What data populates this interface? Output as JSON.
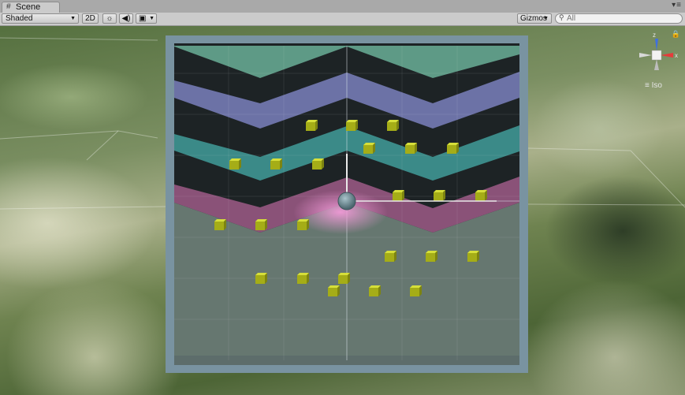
{
  "window": {
    "tab_icon": "#",
    "tab_label": "Scene",
    "tab_menu": "▾≡"
  },
  "toolbar": {
    "shading_mode": "Shaded",
    "btn_2d": "2D",
    "lighting_icon": "☼",
    "audio_icon": "◀)",
    "effects_icon": "▣",
    "gizmos_label": "Gizmos",
    "search_placeholder": "All"
  },
  "gizmo": {
    "x_label": "x",
    "y_label": "y",
    "z_label": "z",
    "projection": "≡ Iso"
  },
  "icons": [
    "scene-tab-icon",
    "dropdown-arrow-icon",
    "lighting-icon",
    "audio-icon",
    "effects-icon",
    "search-icon",
    "lock-icon",
    "orientation-gizmo-icon"
  ],
  "colors": {
    "band_top": "#5e9a86",
    "band_blue": "#6c72a6",
    "band_teal": "#3b8a88",
    "band_pink": "#8a5278",
    "band_dark": "#1d2325",
    "board_frame": "#7993a1",
    "lower_field": "#667770",
    "cube": "#b8c21b",
    "ball": "#6b8a93",
    "axis_x": "#e53b3b",
    "axis_y": "#7bd04a",
    "axis_z": "#3f6fe0"
  },
  "scene": {
    "cubes": [
      [
        395,
        160
      ],
      [
        446,
        160
      ],
      [
        498,
        160
      ],
      [
        468,
        189
      ],
      [
        521,
        189
      ],
      [
        574,
        189
      ],
      [
        298,
        209
      ],
      [
        350,
        209
      ],
      [
        403,
        209
      ],
      [
        505,
        249
      ],
      [
        557,
        249
      ],
      [
        610,
        249
      ],
      [
        279,
        286
      ],
      [
        331,
        286
      ],
      [
        384,
        286
      ],
      [
        495,
        326
      ],
      [
        547,
        326
      ],
      [
        600,
        326
      ],
      [
        331,
        354
      ],
      [
        384,
        354
      ],
      [
        436,
        354
      ],
      [
        423,
        370
      ],
      [
        475,
        370
      ],
      [
        527,
        370
      ]
    ],
    "ball": [
      440,
      255
    ]
  }
}
